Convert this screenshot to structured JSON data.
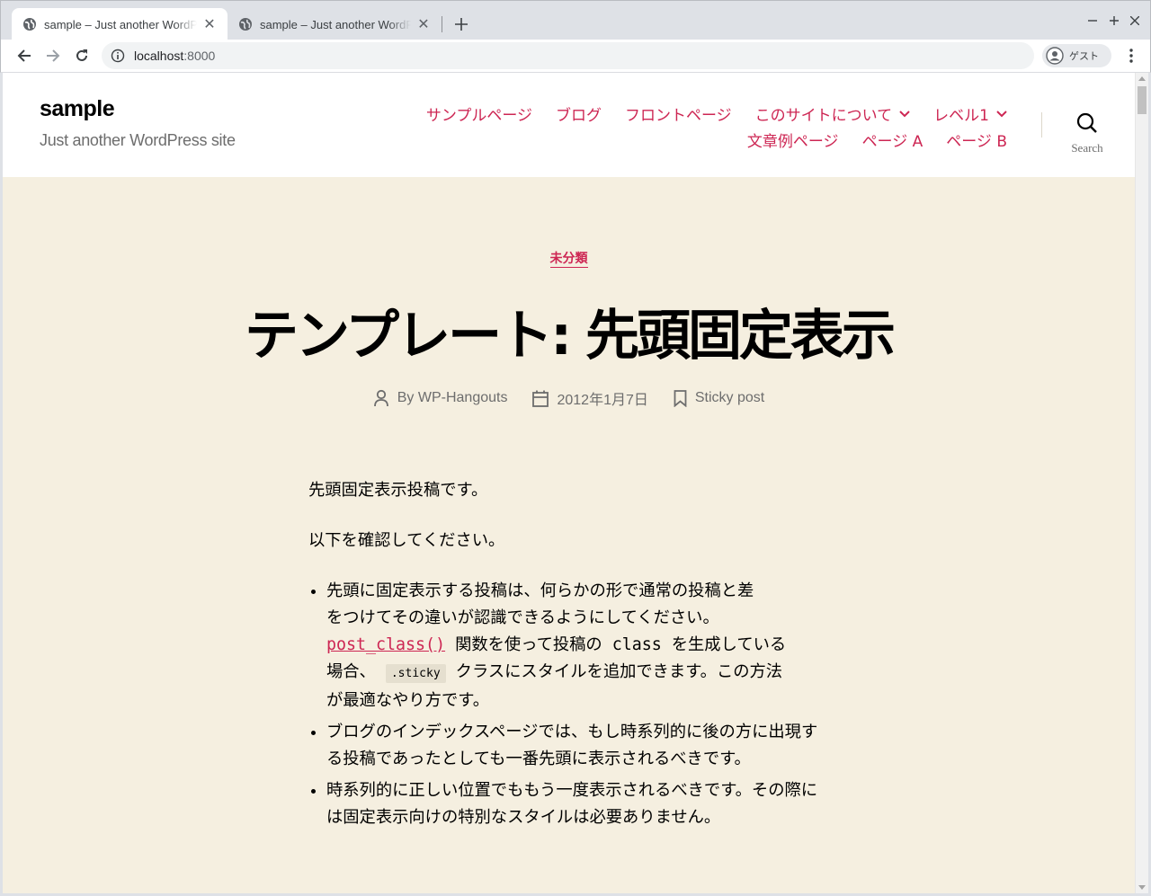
{
  "browser": {
    "tabs": [
      {
        "title": "sample – Just another WordPress site",
        "active": true
      },
      {
        "title": "sample – Just another WordPress site",
        "active": false
      }
    ],
    "new_tab_icon": "plus-icon",
    "window_controls": [
      "minimize-icon",
      "maximize-icon",
      "close-icon"
    ],
    "url_host": "localhost",
    "url_port": ":8000",
    "profile_label": "ゲスト"
  },
  "site": {
    "title": "sample",
    "description": "Just another WordPress site",
    "menu_row1": [
      {
        "label": "サンプルページ",
        "has_submenu": false
      },
      {
        "label": "ブログ",
        "has_submenu": false
      },
      {
        "label": "フロントページ",
        "has_submenu": false
      },
      {
        "label": "このサイトについて",
        "has_submenu": true
      },
      {
        "label": "レベル1",
        "has_submenu": true
      }
    ],
    "menu_row2": [
      {
        "label": "文章例ページ"
      },
      {
        "label": "ページ A"
      },
      {
        "label": "ページ B"
      }
    ],
    "search_label": "Search",
    "accent_color": "#cd2653",
    "background_color": "#f5efe0"
  },
  "post": {
    "category": "未分類",
    "title": "テンプレート: 先頭固定表示",
    "author": "By WP-Hangouts",
    "date": "2012年1月7日",
    "sticky": "Sticky post",
    "paragraphs": [
      "先頭固定表示投稿です。",
      "以下を確認してください。"
    ],
    "list": {
      "item1": {
        "line1": "先頭に固定表示する投稿は、何らかの形で通常の投稿と差",
        "line2": "をつけてその違いが認識できるようにしてください。",
        "link": "post_class()",
        "after_link": " 関数を使って投稿の class を生成している",
        "line4_pre": "場合、",
        "code": ".sticky",
        "line4_post": " クラスにスタイルを追加できます。この方法",
        "line5": "が最適なやり方です。"
      },
      "item2": "ブログのインデックスページでは、もし時系列的に後の方に出現する投稿であったとしても一番先頭に表示されるべきです。",
      "item3": "時系列的に正しい位置でももう一度表示されるべきです。その際には固定表示向けの特別なスタイルは必要ありません。"
    }
  }
}
